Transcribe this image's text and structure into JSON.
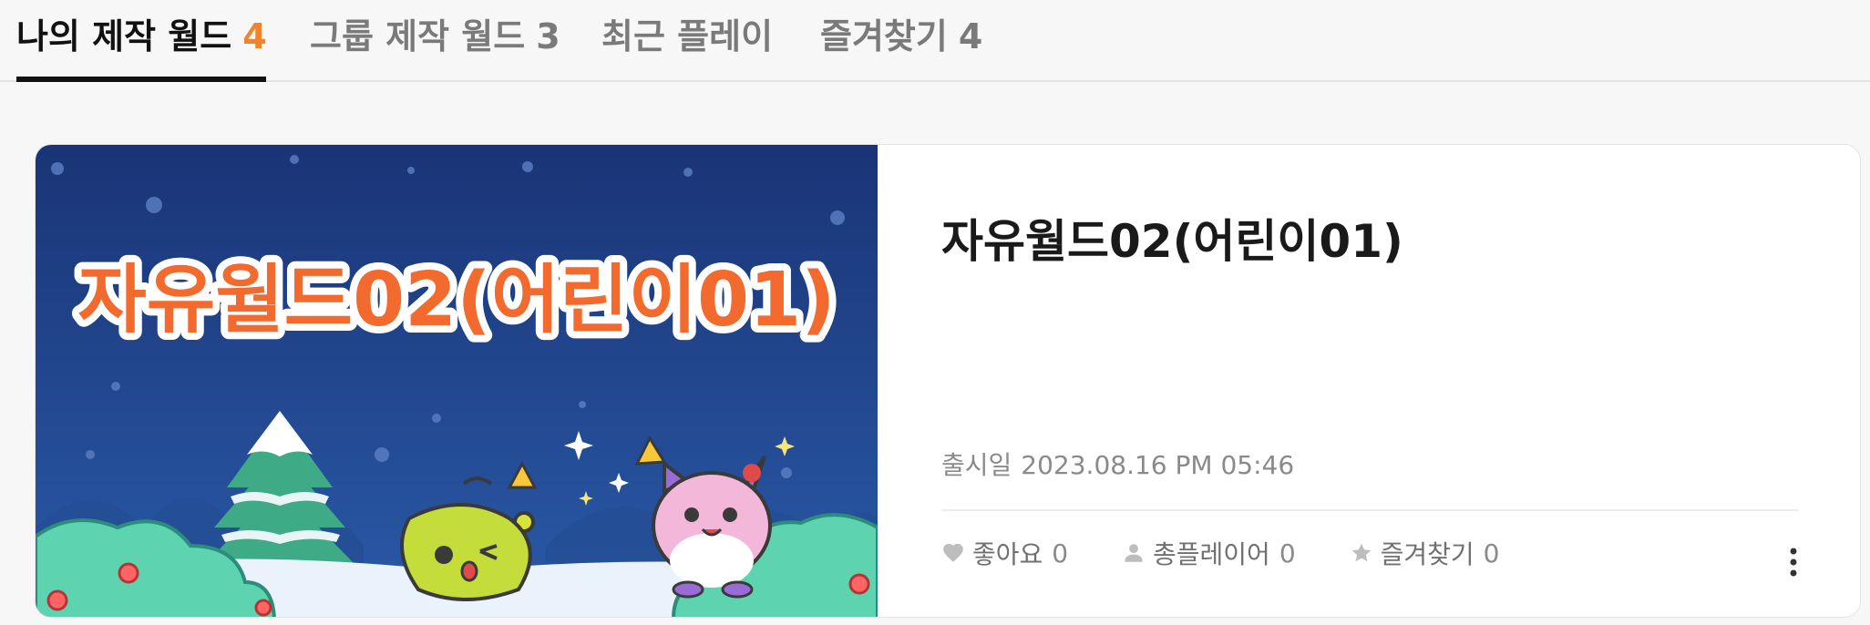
{
  "tabs": [
    {
      "label": "나의 제작 월드",
      "count": "4"
    },
    {
      "label": "그룹 제작 월드",
      "count": "3"
    },
    {
      "label": "최근 플레이",
      "count": ""
    },
    {
      "label": "즐겨찾기",
      "count": "4"
    }
  ],
  "active_tab": "나의 제작 월드",
  "world": {
    "thumbnail_title": "자유월드02(어린이01)",
    "title": "자유월드02(어린이01)",
    "release_label": "출시일",
    "release_date": "2023.08.16 PM 05:46",
    "stats": {
      "likes_label": "좋아요",
      "likes": "0",
      "players_label": "총플레이어",
      "players": "0",
      "favorites_label": "즐겨찾기",
      "favorites": "0"
    }
  },
  "icons": {
    "likes": "heart-icon",
    "players": "person-icon",
    "favorites": "star-icon",
    "more": "more-vertical-icon"
  },
  "colors": {
    "accent": "#f0832b",
    "thumb_bg": "#1d3a7a",
    "thumb_title": "#f26a2e",
    "text_dark": "#1a1a1a",
    "text_muted": "#8a8a8a"
  }
}
